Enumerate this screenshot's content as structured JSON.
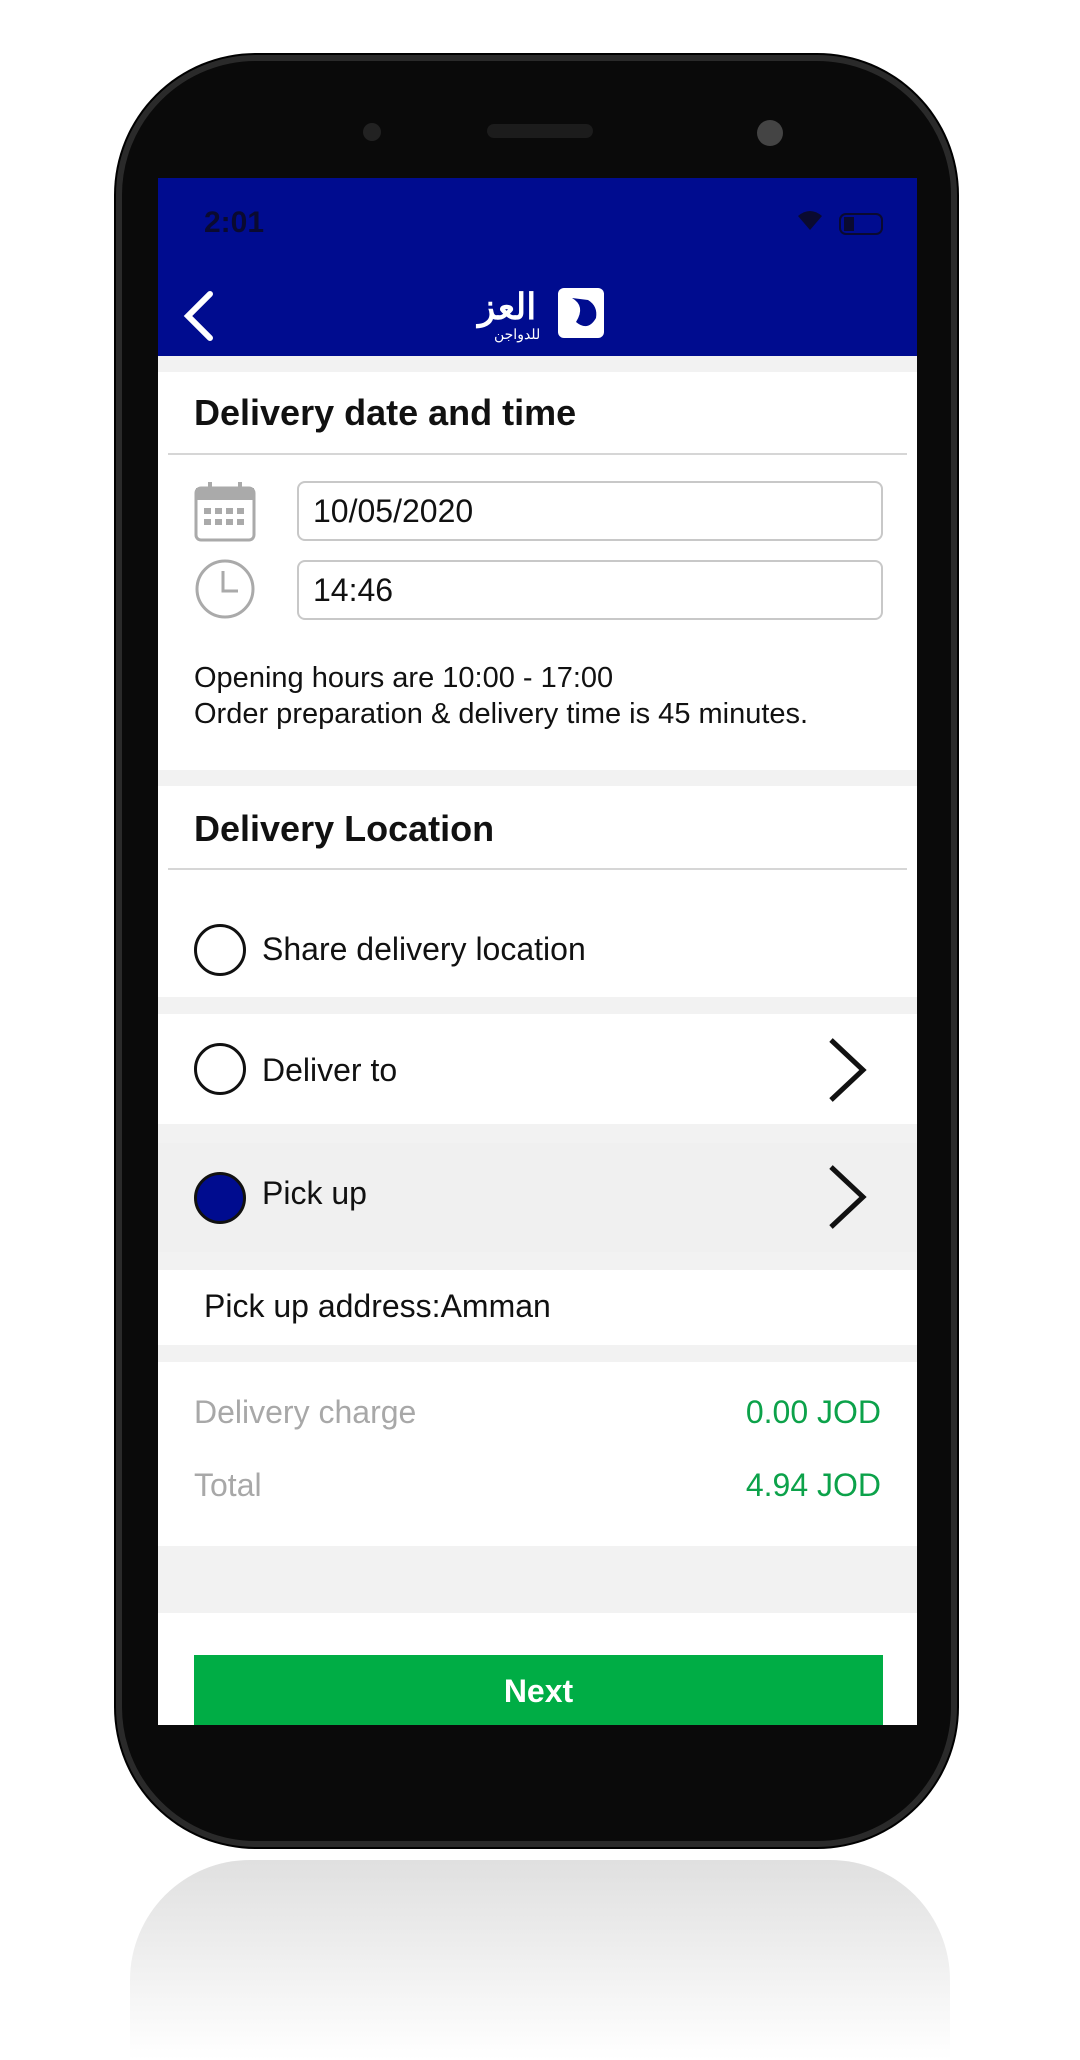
{
  "status_bar": {
    "time": "2:01"
  },
  "header": {
    "logo_text": "العز",
    "logo_sub": "للدواجن"
  },
  "date_section": {
    "title": "Delivery date and time",
    "date_value": "10/05/2020",
    "time_value": "14:46",
    "opening_hours": "Opening hours are  10:00 - 17:00",
    "prep_time": "Order preparation & delivery time is  45 minutes."
  },
  "location_section": {
    "title": "Delivery Location",
    "options": [
      {
        "label": "Share delivery location",
        "selected": false
      },
      {
        "label": "Deliver to",
        "selected": false
      },
      {
        "label": "Pick up",
        "selected": true
      }
    ],
    "pickup_address": "Pick up address:Amman"
  },
  "summary": {
    "delivery_charge_label": "Delivery charge",
    "delivery_charge_value": "0.00 JOD",
    "total_label": "Total",
    "total_value": "4.94 JOD"
  },
  "next_button": "Next",
  "colors": {
    "brand": "#000c8f",
    "accent": "#00ad45",
    "price": "#0ca24a"
  }
}
